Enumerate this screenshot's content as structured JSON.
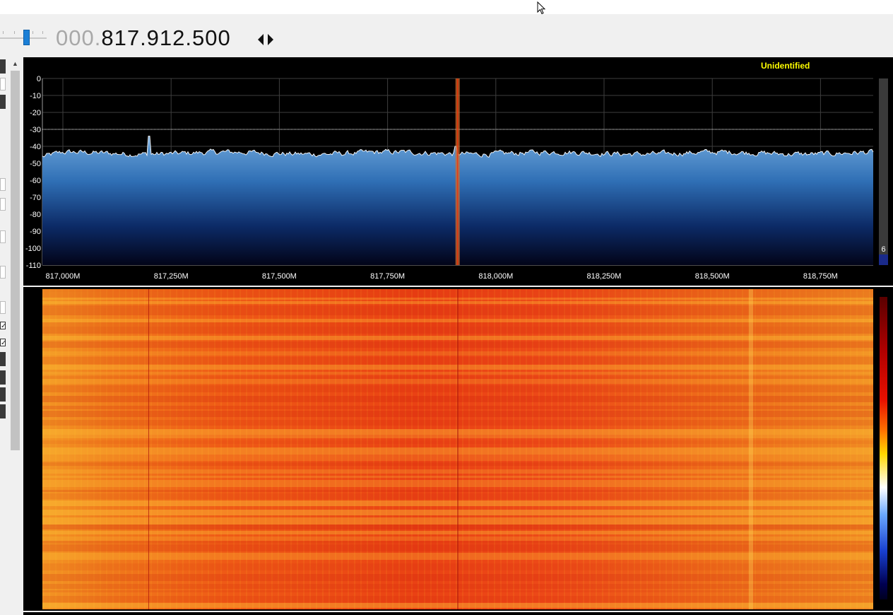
{
  "frequency": {
    "prefix": "000.",
    "main": "817.912.500"
  },
  "spectrum": {
    "mode_label": "Unidentified",
    "y_ticks": [
      "0",
      "-10",
      "-20",
      "-30",
      "-40",
      "-50",
      "-60",
      "-70",
      "-80",
      "-90",
      "-100",
      "-110"
    ],
    "x_ticks": [
      "817,000M",
      "817,250M",
      "817,500M",
      "817,750M",
      "818,000M",
      "818,250M",
      "818,500M",
      "818,750M"
    ],
    "side_value": "6",
    "squelch_db": -30,
    "noise_floor_db": -44,
    "span_mhz": [
      816.955,
      818.871
    ],
    "tuned_mhz": 817.9125,
    "spur_mhz": 817.2
  },
  "colors": {
    "spectrum_fill_top": "#6fa7db",
    "spectrum_fill_bottom": "#020418",
    "tuned_marker": "#d06a2c",
    "waterfall_base": "#ea4214",
    "mode_label": "#ffff00"
  },
  "icons": {
    "step_arrows": "left-right-arrows-icon",
    "scroll_up": "chevron-up-icon",
    "cursor": "mouse-pointer-icon"
  }
}
